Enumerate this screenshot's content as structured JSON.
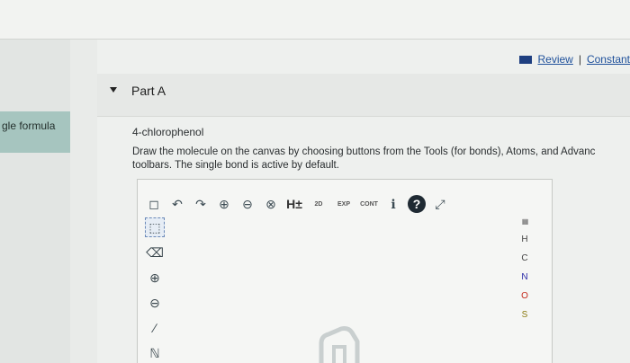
{
  "sidebar": {
    "tab_label": "gle formula"
  },
  "header": {
    "review_link": "Review",
    "separator": "|",
    "constants_link": "Constant"
  },
  "part": {
    "label": "Part A"
  },
  "question": {
    "compound": "4-chlorophenol",
    "line1": "Draw the molecule on the canvas by choosing buttons from the Tools (for bonds), Atoms, and Advanc",
    "line2": "toolbars. The single bond is active by default."
  },
  "toolbar": {
    "items": [
      {
        "name": "new-icon",
        "glyph": "◻"
      },
      {
        "name": "undo-icon",
        "glyph": "↶"
      },
      {
        "name": "redo-icon",
        "glyph": "↷"
      },
      {
        "name": "zoom-in-icon",
        "glyph": "⊕"
      },
      {
        "name": "zoom-out-icon",
        "glyph": "⊖"
      },
      {
        "name": "zoom-fit-icon",
        "glyph": "⊗"
      }
    ],
    "h_label": "H±",
    "label_2d": "2D",
    "label_exp": "EXP",
    "label_cont": "CONT",
    "info_glyph": "ℹ",
    "help_glyph": "?",
    "expand_glyph": "⤢"
  },
  "tools": {
    "select_glyph": "⬚",
    "eraser_glyph": "⌫",
    "plus_glyph": "⊕",
    "minus_glyph": "⊖",
    "bond_glyph": "∕",
    "chain_glyph": "ℕ"
  },
  "atoms": {
    "table_label": "ptable",
    "list": [
      "H",
      "C",
      "N",
      "O",
      "S"
    ]
  }
}
